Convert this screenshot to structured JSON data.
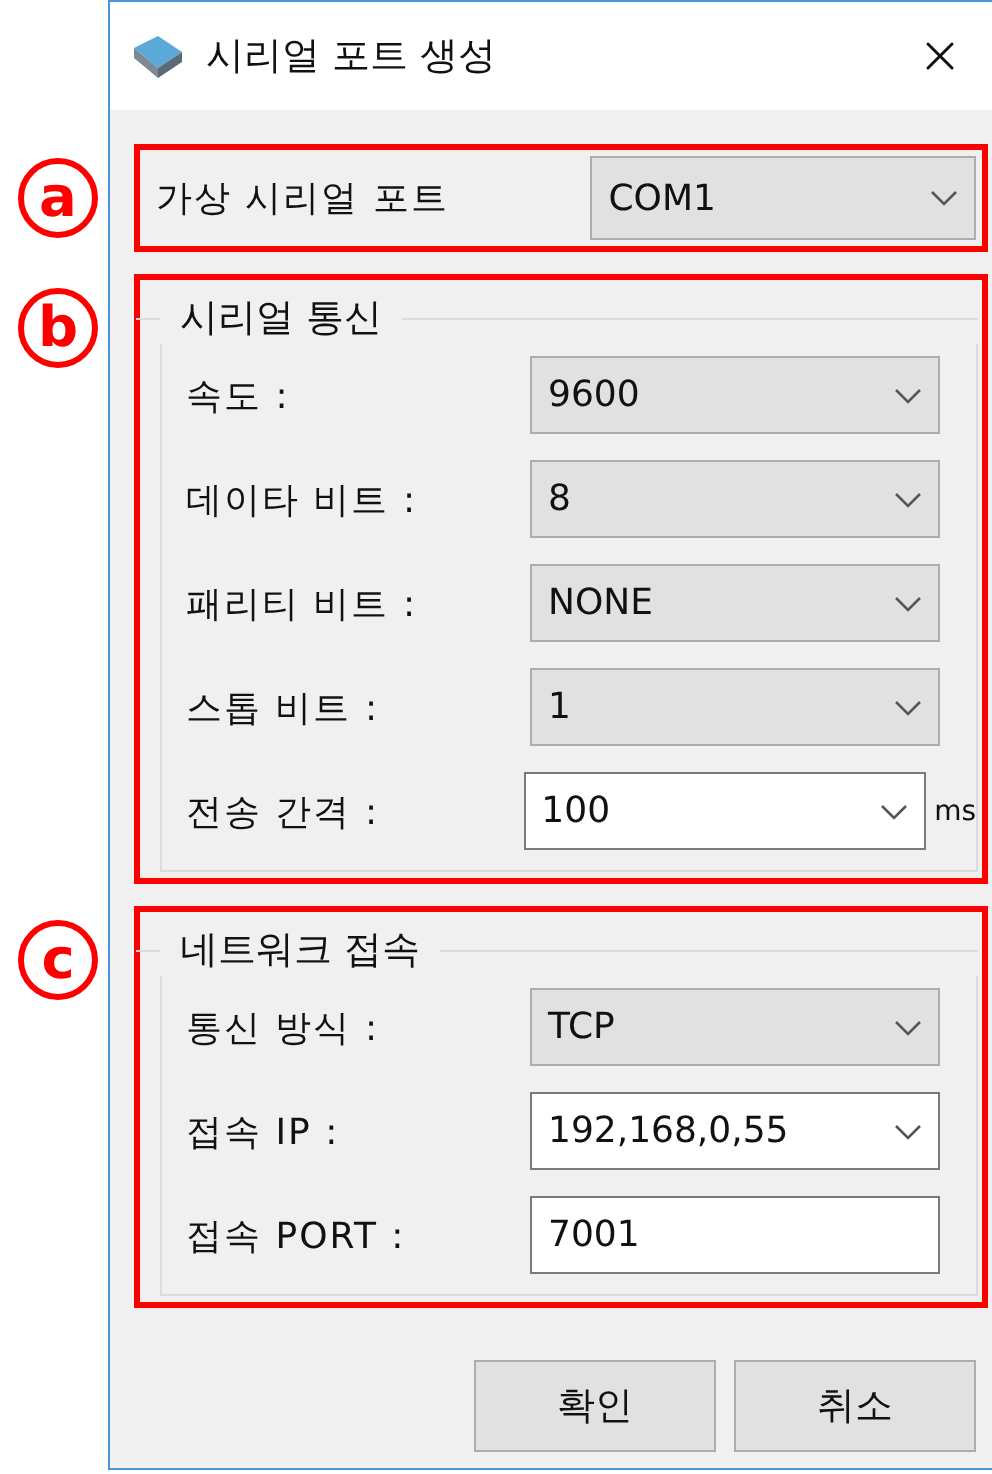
{
  "window": {
    "title": "시리얼 포트 생성"
  },
  "sections": [
    {
      "marker": "a",
      "rows": [
        {
          "label": "가상 시리얼 포트",
          "kind": "combo",
          "value": "COM1"
        }
      ]
    },
    {
      "marker": "b",
      "group_title": "시리얼 통신",
      "rows": [
        {
          "label": "속도 :",
          "kind": "combo",
          "value": "9600"
        },
        {
          "label": "데이타 비트 :",
          "kind": "combo",
          "value": "8"
        },
        {
          "label": "패리티 비트 :",
          "kind": "combo",
          "value": "NONE"
        },
        {
          "label": "스톱 비트 :",
          "kind": "combo",
          "value": "1"
        },
        {
          "label": "전송 간격 :",
          "kind": "editable",
          "value": "100",
          "unit": "ms"
        }
      ]
    },
    {
      "marker": "c",
      "group_title": "네트워크 접속",
      "rows": [
        {
          "label": "통신 방식 :",
          "kind": "combo",
          "value": "TCP"
        },
        {
          "label": "접속 IP :",
          "kind": "editable",
          "value": "192,168,0,55"
        },
        {
          "label": "접속 PORT :",
          "kind": "text",
          "value": "7001"
        }
      ]
    }
  ],
  "buttons": [
    "확인",
    "취소"
  ]
}
